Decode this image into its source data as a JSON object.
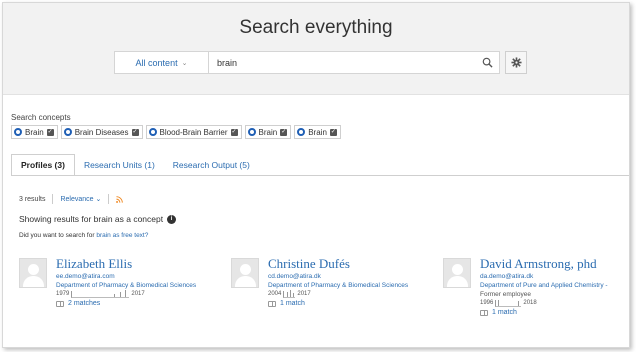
{
  "header": {
    "title": "Search everything",
    "scope_label": "All content",
    "query": "brain"
  },
  "concepts": {
    "label": "Search concepts",
    "items": [
      "Brain",
      "Brain Diseases",
      "Blood-Brain Barrier",
      "Brain",
      "Brain"
    ]
  },
  "tabs": [
    "Profiles (3)",
    "Research Units (1)",
    "Research Output (5)"
  ],
  "results": {
    "count": "3 results",
    "sort": "Relevance",
    "showing": "Showing results for brain as a concept",
    "did_you_mean_prefix": "Did you want to search for",
    "did_you_mean_link": "brain as free text?"
  },
  "profiles": [
    {
      "name": "Elizabeth Ellis",
      "email": "ee.demo@atira.com",
      "dept": "Department of Pharmacy & Biomedical Sciences",
      "extra": "",
      "start": "1979",
      "end": "2017",
      "matches": "2 matches"
    },
    {
      "name": "Christine Dufés",
      "email": "cd.demo@atira.dk",
      "dept": "Department of Pharmacy & Biomedical Sciences",
      "extra": "",
      "start": "2004",
      "end": "2017",
      "matches": "1 match"
    },
    {
      "name": "David Armstrong, phd",
      "email": "da.demo@atira.dk",
      "dept": "Department of Pure and Applied Chemistry -",
      "extra": "Former employee",
      "start": "1996",
      "end": "2018",
      "matches": "1 match"
    }
  ]
}
